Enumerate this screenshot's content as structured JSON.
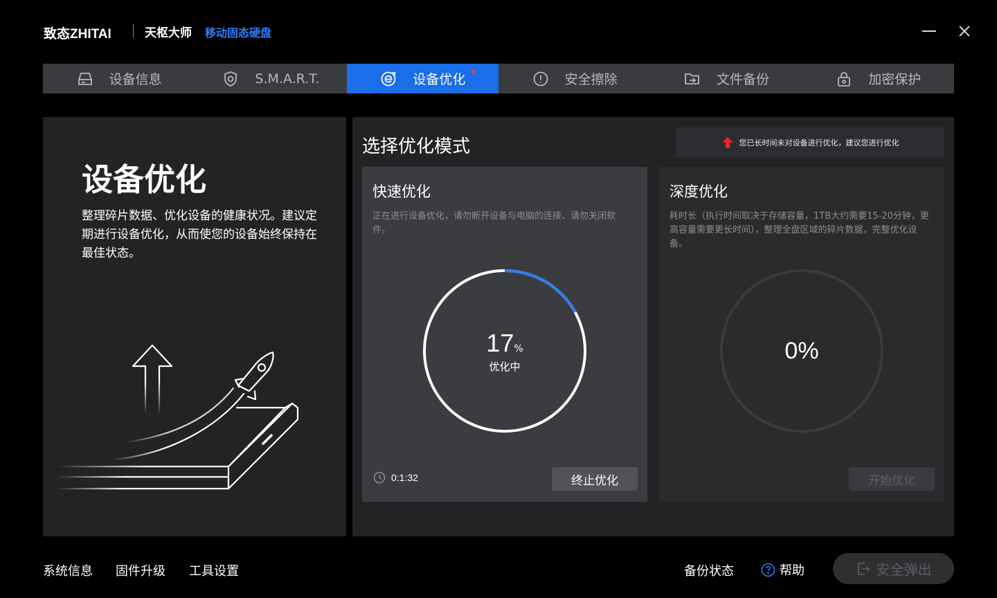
{
  "header": {
    "brand": "致态ZHITAI",
    "product": "天枢大师",
    "product_sub": "移动固态硬盘",
    "minimize_icon": "minimize-icon",
    "close_icon": "close-icon"
  },
  "tabs": [
    {
      "label": "设备信息",
      "icon": "drive-icon",
      "active": false
    },
    {
      "label": "S.M.A.R.T.",
      "icon": "shield-icon",
      "active": false
    },
    {
      "label": "设备优化",
      "icon": "optimize-icon",
      "active": true,
      "badge": true
    },
    {
      "label": "安全擦除",
      "icon": "alert-shield-icon",
      "active": false
    },
    {
      "label": "文件备份",
      "icon": "folder-backup-icon",
      "active": false
    },
    {
      "label": "加密保护",
      "icon": "lock-icon",
      "active": false
    }
  ],
  "left": {
    "title": "设备优化",
    "desc": "整理碎片数据、优化设备的健康状况。建议定期进行设备优化，从而使您的设备始终保持在最佳状态。"
  },
  "right": {
    "title": "选择优化模式",
    "notice": "您已长时间未对设备进行优化，建议您进行优化"
  },
  "quick": {
    "title": "快速优化",
    "desc": "正在进行设备优化，请勿断开设备与电脑的连接、请勿关闭软件。",
    "progress": 17,
    "pct_unit": "%",
    "status": "优化中",
    "timer": "0:1:32",
    "button": "终止优化"
  },
  "deep": {
    "title": "深度优化",
    "desc": "耗时长（执行时间取决于存储容量，1TB大约需要15-20分钟，更高容量需要更长时间），整理全盘区域的碎片数据，完整优化设备。",
    "progress_text": "0%",
    "button": "开始优化"
  },
  "footer": {
    "system_info": "系统信息",
    "firmware": "固件升级",
    "settings": "工具设置",
    "backup_status": "备份状态",
    "help": "帮助",
    "eject": "安全弹出"
  },
  "colors": {
    "accent": "#1a6ee8",
    "brand_blue": "#2f7cf6",
    "badge_red": "#ff3b3b"
  }
}
